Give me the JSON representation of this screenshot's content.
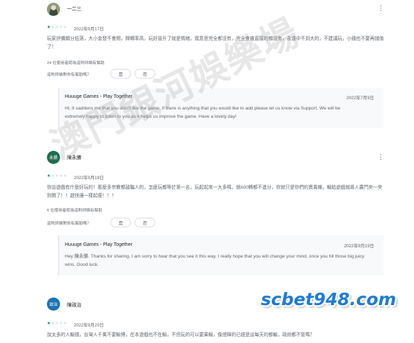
{
  "reviews": [
    {
      "avatar_text": "",
      "avatar_color": "#8d9c7a",
      "name": "一二三",
      "more_icon": "⋮",
      "stars": "★★★★★",
      "date": "2022年9月17日",
      "text": "玩家評價頗分低落，大小金發不會開，牌轉率高，玩好晉升了就是情緒，我意思完全都沒有，完全會被直接的都沒有，永遠中不到大的，不建議玩，小錢也不要再儲值了！",
      "helpful_count": "24 位使用者認為這則評論有幫助",
      "helpful_question": "這則評論對你有幫助嗎？",
      "yes_label": "是",
      "no_label": "否",
      "reply": {
        "developer": "Huuuge Games - Play Together",
        "date": "2022年7月9日",
        "text": "Hi, It saddens me that you didn't like the game. If there is anything that you would like to add please let us know via Support. We will be extremely happy to listen to you as it helps us improve the game. Have a lovely day!"
      }
    },
    {
      "avatar_text": "永勝",
      "avatar_color": "#1e6e4e",
      "name": "陳永勝",
      "more_icon": "⋮",
      "stars": "★★★★★",
      "date": "2022年9月19日",
      "text": "你這遊戲有什麼好玩的！那麼多宗教都鼓騙人的，怎麼玩都等於第一名，玩起起來一大多嗎，就600轉都不進分，你就只是你們的賣貴機，輸給遊戲就將人農門央一央別開了！！趕快讓一樣起便！！！",
      "helpful_count": "6 位使用者認為這則評論有幫助",
      "helpful_question": "這則評論對你有幫助嗎？",
      "yes_label": "是",
      "no_label": "否",
      "reply": {
        "developer": "Huuuge Games - Play Together",
        "date": "2022年9月19日",
        "text": "Hey 陳永勝. Thanks for sharing. I am sorry to hear that you see it this way. I really hope that you will change your mind, once you hit those big juicy wins. Good luck."
      }
    },
    {
      "avatar_text": "政治",
      "avatar_color": "#1a73b8",
      "name": "陳政治",
      "more_icon": "⋮",
      "stars": "★★★★★",
      "date": "2022年9月20日",
      "text": "說太多的人輸錢，台灣人千萬不要輸博，在本遊戲也不在輸，不但玩的可以要果輸，像總歸的已經是這每天的都輸，政府都不管嗎？"
    }
  ],
  "watermark": {
    "text": "澳門銀河娛樂場",
    "logo": "scbet948.com"
  },
  "rating": 1
}
